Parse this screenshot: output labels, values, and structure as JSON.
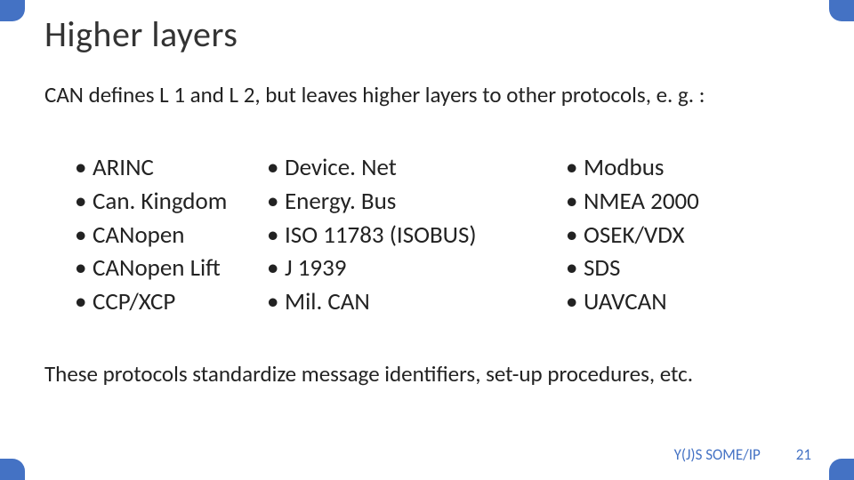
{
  "title": "Higher layers",
  "intro": "CAN defines L 1 and L 2, but leaves higher layers to other protocols, e. g. :",
  "columns": {
    "c1": [
      "ARINC",
      "Can. Kingdom",
      "CANopen",
      "CANopen Lift",
      "CCP/XCP"
    ],
    "c2": [
      "Device. Net",
      "Energy. Bus",
      "ISO 11783 (ISOBUS)",
      "J 1939",
      "Mil. CAN"
    ],
    "c3": [
      "Modbus",
      "NMEA 2000",
      "OSEK/VDX",
      "SDS",
      "UAVCAN"
    ]
  },
  "outro": "These protocols standardize message identifiers, set-up procedures, etc.",
  "footer_source": "Y(J)S  SOME/IP",
  "page_number": "21",
  "accent_color": "#4472c4"
}
